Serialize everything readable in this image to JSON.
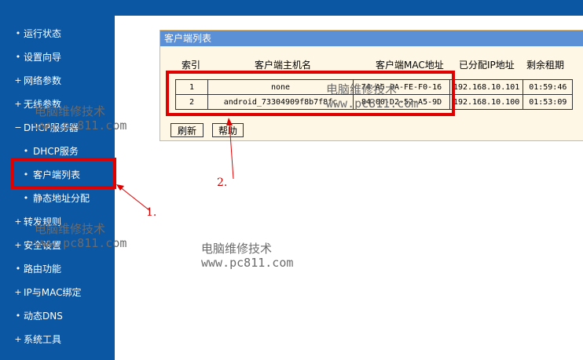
{
  "sidebar": {
    "items": [
      {
        "mark": "•",
        "label": "运行状态",
        "sub": false
      },
      {
        "mark": "•",
        "label": "设置向导",
        "sub": false
      },
      {
        "mark": "+",
        "label": "网络参数",
        "sub": false
      },
      {
        "mark": "+",
        "label": "无线参数",
        "sub": false
      },
      {
        "mark": "−",
        "label": "DHCP服务器",
        "sub": false
      },
      {
        "mark": "•",
        "label": "DHCP服务",
        "sub": true
      },
      {
        "mark": "•",
        "label": "客户端列表",
        "sub": true
      },
      {
        "mark": "•",
        "label": "静态地址分配",
        "sub": true
      },
      {
        "mark": "+",
        "label": "转发规则",
        "sub": false
      },
      {
        "mark": "+",
        "label": "安全设置",
        "sub": false
      },
      {
        "mark": "•",
        "label": "路由功能",
        "sub": false
      },
      {
        "mark": "+",
        "label": "IP与MAC绑定",
        "sub": false
      },
      {
        "mark": "•",
        "label": "动态DNS",
        "sub": false
      },
      {
        "mark": "+",
        "label": "系统工具",
        "sub": false
      }
    ]
  },
  "panel": {
    "title": "客户端列表",
    "columns": [
      "索引",
      "客户端主机名",
      "客户端MAC地址",
      "已分配IP地址",
      "剩余租期"
    ],
    "rows": [
      {
        "index": "1",
        "host": "none",
        "mac": "74-A5-0A-FE-F0-16",
        "ip": "192.168.10.101",
        "lease": "01:59:46"
      },
      {
        "index": "2",
        "host": "android_73304909f8b7f8fc",
        "mac": "84-00-D2-52-A5-9D",
        "ip": "192.168.10.100",
        "lease": "01:53:09"
      }
    ],
    "refresh_label": "刷新",
    "help_label": "帮助"
  },
  "watermark": {
    "line1": "电脑维修技术",
    "line2": "www.pc811.com"
  },
  "annotations": {
    "step1": "1.",
    "step2": "2."
  },
  "colors": {
    "nav_bg": "#0b57a4",
    "panel_head": "#5b8fd6",
    "highlight": "#e00000"
  }
}
